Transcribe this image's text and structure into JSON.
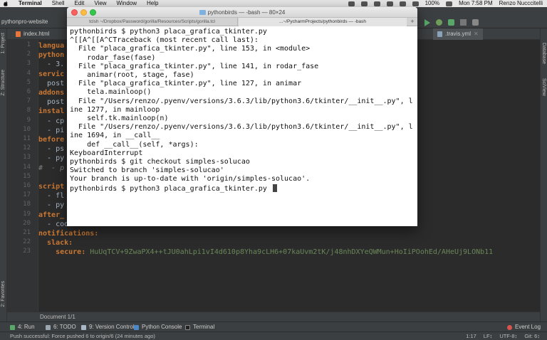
{
  "menubar": {
    "app_name": "Terminal",
    "items": [
      "Shell",
      "Edit",
      "View",
      "Window",
      "Help"
    ],
    "battery": "100%",
    "clock": "Mon 7:58 PM",
    "user": "Renzo Nucccitelli"
  },
  "ide": {
    "project_name": "pythonpro-website",
    "tabs": {
      "index": "index.html",
      "travis": ".travis.yml"
    },
    "side_labels": {
      "project": "1: Project",
      "structure": "Z: Structure",
      "favorites": "2: Favorites",
      "database": "Database",
      "sciview": "SciView"
    },
    "line_numbers": [
      "1",
      "2",
      "3",
      "4",
      "5",
      "6",
      "7",
      "8",
      "9",
      "10",
      "11",
      "12",
      "13",
      "14",
      "15",
      "16",
      "17",
      "18",
      "19",
      "20",
      "21",
      "22",
      "23"
    ],
    "code_lines": [
      [
        {
          "t": "langua",
          "c": "k"
        }
      ],
      [
        {
          "t": "python",
          "c": "k"
        }
      ],
      [
        {
          "t": "  - 3.",
          "c": "v"
        }
      ],
      [
        {
          "t": "servic",
          "c": "k"
        }
      ],
      [
        {
          "t": "  post",
          "c": "v"
        }
      ],
      [
        {
          "t": "addons",
          "c": "k"
        }
      ],
      [
        {
          "t": "  post",
          "c": "v"
        }
      ],
      [
        {
          "t": "instal",
          "c": "k"
        }
      ],
      [
        {
          "t": "  - cp",
          "c": "v"
        }
      ],
      [
        {
          "t": "  - pi",
          "c": "v"
        }
      ],
      [
        {
          "t": "before",
          "c": "k"
        }
      ],
      [
        {
          "t": "  - ps",
          "c": "v"
        }
      ],
      [
        {
          "t": "  - py",
          "c": "v"
        }
      ],
      [
        {
          "t": "#  - p",
          "c": "c"
        }
      ],
      [
        {
          "t": "",
          "c": "v"
        }
      ],
      [
        {
          "t": "script",
          "c": "k"
        }
      ],
      [
        {
          "t": "  - fl",
          "c": "v"
        }
      ],
      [
        {
          "t": "  - py",
          "c": "v"
        }
      ],
      [
        {
          "t": "after_",
          "c": "k"
        }
      ],
      [
        {
          "t": "  - codecov",
          "c": "v"
        }
      ],
      [
        {
          "t": "notifications:",
          "c": "k"
        }
      ],
      [
        {
          "t": "  slack:",
          "c": "k"
        }
      ],
      [
        {
          "t": "    secure: ",
          "c": "k"
        },
        {
          "t": "HuUqTCV+9ZwaPX4++tJU0ahLpi1vI4d610p8Yha9cLH6+07kaUvm2tK/j48nhDXYeQWMun+HoIiPOohEd/AHeUj9LONb11",
          "c": "s"
        }
      ]
    ],
    "document_status": "Document 1/1",
    "tool_windows": [
      "4: Run",
      "6: TODO",
      "9: Version Control",
      "Python Console",
      "Terminal",
      "Event Log"
    ],
    "status_message": "Push successful: Force pushed 6 to origin/6 (24 minutes ago)",
    "status_right": [
      "1:17",
      "LF↕",
      "UTF-8↕",
      "Git: 6↕"
    ]
  },
  "terminal": {
    "title": "pythonbirds — -bash — 80×24",
    "tabs": [
      "tclsh ~/Dropbox/Password/gorilla/Resources/Scripts/gorilla.tcl",
      "...~/PycharmProjects/pythonbirds — -bash"
    ],
    "add_tab": "+",
    "lines": [
      "pythonbirds $ python3 placa_grafica_tkinter.py",
      "^[[A^[[A^CTraceback (most recent call last):",
      "  File \"placa_grafica_tkinter.py\", line 153, in <module>",
      "    rodar_fase(fase)",
      "  File \"placa_grafica_tkinter.py\", line 141, in rodar_fase",
      "    animar(root, stage, fase)",
      "  File \"placa_grafica_tkinter.py\", line 127, in animar",
      "    tela.mainloop()",
      "  File \"/Users/renzo/.pyenv/versions/3.6.3/lib/python3.6/tkinter/__init__.py\", l",
      "ine 1277, in mainloop",
      "    self.tk.mainloop(n)",
      "  File \"/Users/renzo/.pyenv/versions/3.6.3/lib/python3.6/tkinter/__init__.py\", l",
      "ine 1694, in __call__",
      "    def __call__(self, *args):",
      "KeyboardInterrupt",
      "pythonbirds $ git checkout simples-solucao",
      "Switched to branch 'simples-solucao'",
      "Your branch is up-to-date with 'origin/simples-solucao'.",
      "pythonbirds $ python3 placa_grafica_tkinter.py "
    ]
  }
}
